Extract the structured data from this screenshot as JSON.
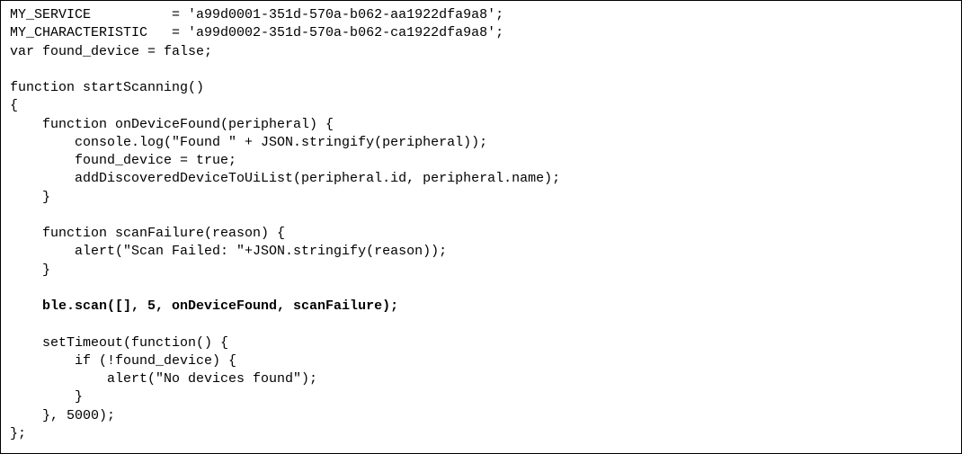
{
  "code": {
    "lines": [
      "MY_SERVICE          = 'a99d0001-351d-570a-b062-aa1922dfa9a8';",
      "MY_CHARACTERISTIC   = 'a99d0002-351d-570a-b062-ca1922dfa9a8';",
      "var found_device = false;",
      "",
      "function startScanning()",
      "{",
      "    function onDeviceFound(peripheral) {",
      "        console.log(\"Found \" + JSON.stringify(peripheral));",
      "        found_device = true;",
      "        addDiscoveredDeviceToUiList(peripheral.id, peripheral.name);",
      "    }",
      "",
      "    function scanFailure(reason) {",
      "        alert(\"Scan Failed: \"+JSON.stringify(reason));",
      "    }",
      "",
      "    ble.scan([], 5, onDeviceFound, scanFailure);",
      "",
      "    setTimeout(function() {",
      "        if (!found_device) {",
      "            alert(\"No devices found\");",
      "        }",
      "    }, 5000);",
      "};"
    ],
    "bold_line_index": 16
  }
}
